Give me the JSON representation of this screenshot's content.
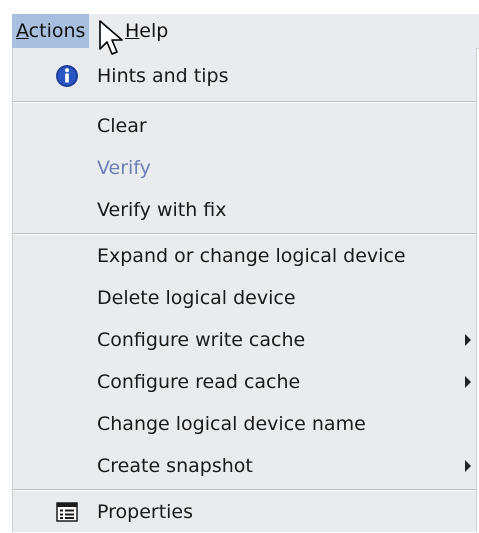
{
  "menubar": {
    "actions": {
      "underline": "A",
      "rest": "ctions"
    },
    "help": {
      "underline": "H",
      "rest": "elp"
    }
  },
  "menu": {
    "hints": {
      "label": "Hints and tips",
      "icon": "info-icon"
    },
    "clear": {
      "label": "Clear"
    },
    "verify": {
      "label": "Verify",
      "disabled": true
    },
    "verify_fix": {
      "label": "Verify with fix"
    },
    "expand": {
      "label": "Expand or change logical device"
    },
    "delete": {
      "label": "Delete logical device"
    },
    "write_cache": {
      "label": "Configure write cache",
      "submenu": true
    },
    "read_cache": {
      "label": "Configure read cache",
      "submenu": true
    },
    "rename": {
      "label": "Change logical device name"
    },
    "snapshot": {
      "label": "Create snapshot",
      "submenu": true
    },
    "properties": {
      "label": "Properties",
      "icon": "properties-icon"
    }
  },
  "colors": {
    "menu_bg": "#e8ecef",
    "active_bg": "#a9bfe0",
    "disabled_text": "#6f7fb6",
    "info_icon": "#1d3f9b"
  }
}
